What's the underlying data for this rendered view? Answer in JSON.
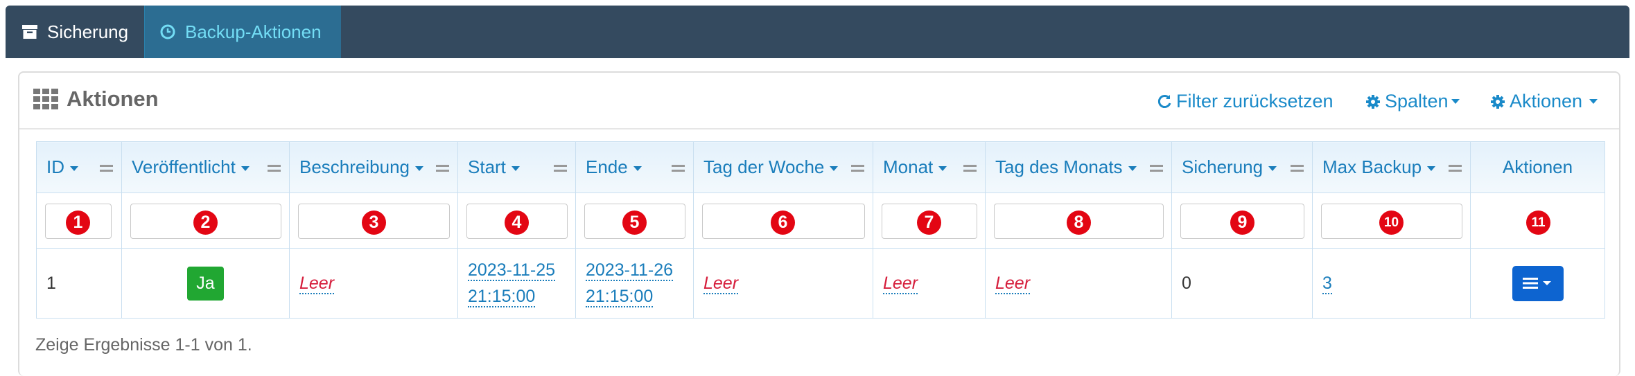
{
  "tabs": [
    {
      "label": "Sicherung",
      "icon": "archive-icon"
    },
    {
      "label": "Backup-Aktionen",
      "icon": "clock-icon",
      "active": true
    }
  ],
  "panel": {
    "title": "Aktionen",
    "reset_filter": "Filter zurücksetzen",
    "columns_menu": "Spalten",
    "actions_menu": "Aktionen"
  },
  "table": {
    "headers": [
      "ID",
      "Veröffentlicht",
      "Beschreibung",
      "Start",
      "Ende",
      "Tag der Woche",
      "Monat",
      "Tag des Monats",
      "Sicherung",
      "Max Backup",
      "Aktionen"
    ],
    "filter_badges": [
      "1",
      "2",
      "3",
      "4",
      "5",
      "6",
      "7",
      "8",
      "9",
      "10",
      "11"
    ],
    "rows": [
      {
        "id": "1",
        "published": "Ja",
        "description": "Leer",
        "start_date": "2023-11-25",
        "start_time": "21:15:00",
        "end_date": "2023-11-26",
        "end_time": "21:15:00",
        "weekday": "Leer",
        "month": "Leer",
        "day_of_month": "Leer",
        "backup": "0",
        "max_backup": "3"
      }
    ]
  },
  "footer": "Zeige Ergebnisse 1-1 von 1.",
  "colors": {
    "topbar": "#344a5f",
    "active_tab": "#2c6d92",
    "link": "#1a8ac9",
    "badge": "#e30613",
    "published_button": "#21a732",
    "action_button": "#0d64d0"
  }
}
